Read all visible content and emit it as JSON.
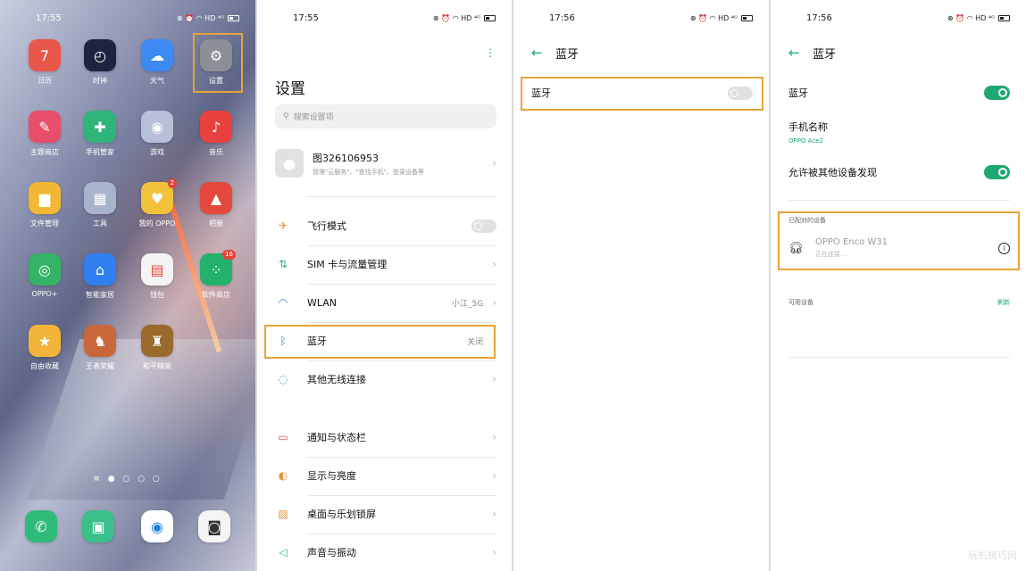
{
  "screens": {
    "home": {
      "time": "17:55",
      "apps": [
        {
          "label": "日历",
          "glyph": "7",
          "color": "#e9574b"
        },
        {
          "label": "时钟",
          "glyph": "◴",
          "color": "#1d2340"
        },
        {
          "label": "天气",
          "glyph": "☁",
          "color": "#3d8af2"
        },
        {
          "label": "设置",
          "glyph": "⚙",
          "color": "#8d8f98"
        },
        {
          "label": "主题商店",
          "glyph": "✎",
          "color": "#e84e6a"
        },
        {
          "label": "手机管家",
          "glyph": "✚",
          "color": "#2fb47a"
        },
        {
          "label": "游戏",
          "glyph": "◉",
          "color": "#b7c0d8"
        },
        {
          "label": "音乐",
          "glyph": "♪",
          "color": "#e8413d"
        },
        {
          "label": "文件管理",
          "glyph": "▆",
          "color": "#f2b733"
        },
        {
          "label": "工具",
          "glyph": "▦",
          "color": "#aab3cc"
        },
        {
          "label": "我的 OPPO",
          "glyph": "♥",
          "color": "#f2c23a",
          "badge": "2"
        },
        {
          "label": "相册",
          "glyph": "▲",
          "color": "#e5483d"
        },
        {
          "label": "OPPO+",
          "glyph": "◎",
          "color": "#34b366"
        },
        {
          "label": "智能家居",
          "glyph": "⌂",
          "color": "#2f7ff0"
        },
        {
          "label": "钱包",
          "glyph": "▤",
          "color": "#f4f4f4"
        },
        {
          "label": "软件商店",
          "glyph": "⁘",
          "color": "#22b26b",
          "badge": "16"
        },
        {
          "label": "自由收藏",
          "glyph": "★",
          "color": "#f2b43a"
        },
        {
          "label": "王者荣耀",
          "glyph": "♞",
          "color": "#c9673a"
        },
        {
          "label": "和平精英",
          "glyph": "♜",
          "color": "#9a6a2c"
        }
      ],
      "dock": [
        {
          "name": "phone",
          "glyph": "✆",
          "color": "#2fbb7a"
        },
        {
          "name": "messages",
          "glyph": "▣",
          "color": "#3bbf8b"
        },
        {
          "name": "browser",
          "glyph": "◉",
          "color": "#ffffff"
        },
        {
          "name": "camera",
          "glyph": "◙",
          "color": "#f5f5f5"
        }
      ],
      "page_indicator": "≡ ● ○ ○ ○"
    },
    "settings": {
      "time": "17:55",
      "title": "设置",
      "search_placeholder": "搜索设置项",
      "account_name": "图326106953",
      "account_sub": "管理\"云服务\"、\"查找手机\"、登录设备等",
      "rows": [
        {
          "label": "飞行模式",
          "value": "",
          "icon": "✈"
        },
        {
          "label": "SIM 卡与流量管理",
          "value": "",
          "icon": "⇅"
        },
        {
          "label": "WLAN",
          "value": "小江_5G",
          "icon": "◠"
        },
        {
          "label": "蓝牙",
          "value": "关闭",
          "icon": "ᛒ"
        },
        {
          "label": "其他无线连接",
          "value": "",
          "icon": "◌"
        },
        {
          "label": "通知与状态栏",
          "value": "",
          "icon": "▭"
        },
        {
          "label": "显示与亮度",
          "value": "",
          "icon": "◐"
        },
        {
          "label": "桌面与乐划锁屏",
          "value": "",
          "icon": "▨"
        },
        {
          "label": "声音与振动",
          "value": "",
          "icon": "◁"
        }
      ]
    },
    "bt_off": {
      "time": "17:56",
      "title": "蓝牙",
      "toggle_label": "蓝牙"
    },
    "bt_on": {
      "time": "17:56",
      "title": "蓝牙",
      "toggle_label": "蓝牙",
      "phone_name_label": "手机名称",
      "phone_name_value": "OPPO Ace2",
      "discover_label": "允许被其他设备发现",
      "paired_head": "已配对的设备",
      "paired_device_name": "OPPO Enco W31",
      "paired_device_status": "正在连接...",
      "available_head": "可用设备",
      "refresh_label": "刷新",
      "watermark": "玩机技巧网"
    }
  },
  "status_icons": "⊗ ⏰ ◠ HD ⁴ᴳ",
  "colors": {
    "accent": "#1aa876",
    "highlight": "#e8a33a"
  }
}
